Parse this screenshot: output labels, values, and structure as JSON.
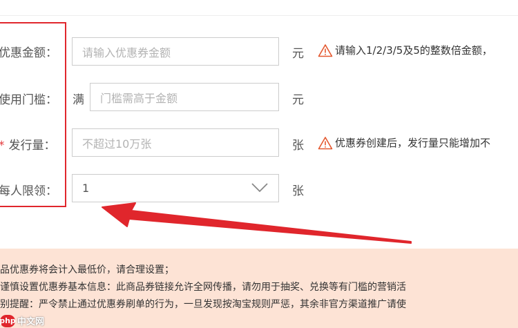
{
  "header": {
    "fragment": ""
  },
  "form": {
    "rows": [
      {
        "label": "优惠金额：",
        "placeholder": "请输入优惠券金额",
        "unit": "元",
        "hint": "请输入1/2/3/5及5的整数倍金额，"
      },
      {
        "label": "使用门槛：",
        "prefix": "满",
        "placeholder": "门槛需高于金额",
        "unit": "元"
      },
      {
        "label": "发行量：",
        "required_star": "*",
        "placeholder": "不超过10万张",
        "unit": "张",
        "hint": "优惠券创建后，发行量只能增加不"
      },
      {
        "label": "每人限领：",
        "value": "1",
        "unit": "张"
      }
    ]
  },
  "notice": {
    "lines": [
      "品优惠券将会计入最低价，请合理设置；",
      "谨慎设置优惠券基本信息：此商品券链接允许全网传播，请勿用于抽奖、兑换等有门槛的营销活",
      "别提醒：严令禁止通过优惠券刷单的行为，一旦发现按淘宝规则严惩，其余非官方渠道推广请使"
    ]
  },
  "watermark": {
    "badge": "php",
    "text": "中文网"
  },
  "colors": {
    "accent_red": "#e0262c",
    "warning_orange": "#e4572e",
    "notice_bg": "#fde3d5"
  }
}
